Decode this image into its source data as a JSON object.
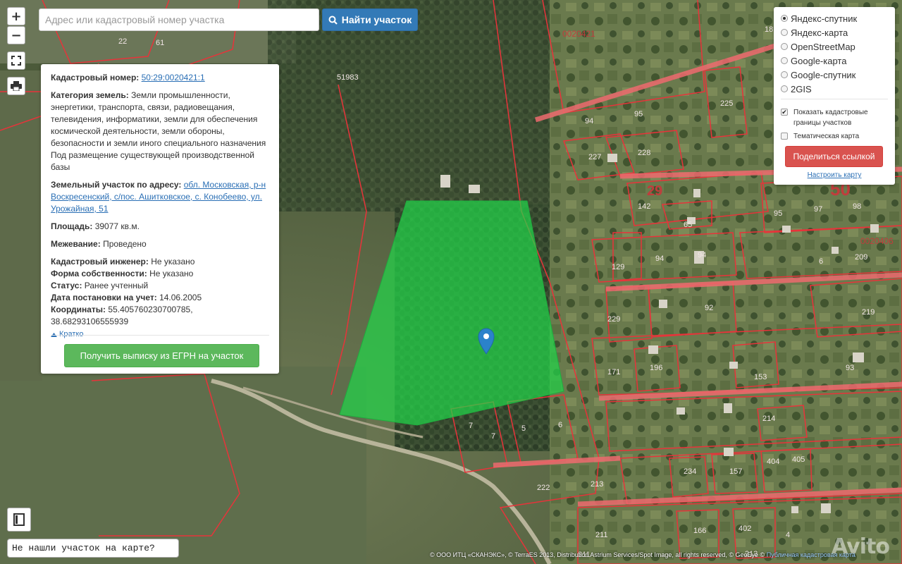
{
  "search": {
    "placeholder": "Адрес или кадастровый номер участка",
    "button_label": "Найти участок"
  },
  "controls": {
    "zoom_in": "+",
    "zoom_out": "−"
  },
  "parcel": {
    "cadastral_label": "Кадастровый номер:",
    "cadastral_value": "50:29:0020421:1",
    "category_label": "Категория земель:",
    "category_value": "Земли промышленности, энергетики, транспорта, связи, радиовещания, телевидения, информатики, земли для обеспечения космической деятельности, земли обороны, безопасности и земли иного специального назначения",
    "usage": "Под размещение существующей производственной базы",
    "address_label": "Земельный участок по адресу:",
    "address_value": "обл. Московская, р-н Воскресенский, с/пос. Ашитковское, с. Конобеево, ул. Урожайная, 51",
    "area_label": "Площадь:",
    "area_value": "39077 кв.м.",
    "survey_label": "Межевание:",
    "survey_value": "Проведено",
    "engineer_label": "Кадастровый инженер:",
    "engineer_value": "Не указано",
    "ownership_label": "Форма собственности:",
    "ownership_value": "Не указано",
    "status_label": "Статус:",
    "status_value": "Ранее учтенный",
    "date_label": "Дата постановки на учет:",
    "date_value": "14.06.2005",
    "coords_label": "Координаты:",
    "coords_value": "55.405760230700785, 38.68293106555939",
    "collapse_label": "Кратко",
    "egrn_button": "Получить выписку из ЕГРН на участок"
  },
  "layers": {
    "options": [
      {
        "label": "Яндекс-спутник",
        "selected": true
      },
      {
        "label": "Яндекс-карта",
        "selected": false
      },
      {
        "label": "OpenStreetMap",
        "selected": false
      },
      {
        "label": "Google-карта",
        "selected": false
      },
      {
        "label": "Google-спутник",
        "selected": false
      },
      {
        "label": "2GIS",
        "selected": false
      }
    ],
    "show_boundaries_label": "Показать кадастровые границы участков",
    "show_boundaries_checked": true,
    "thematic_label": "Тематическая карта",
    "thematic_checked": false,
    "share_button": "Поделиться ссылкой",
    "configure_link": "Настроить карту"
  },
  "not_found_button": "Не нашли участок на карте?",
  "attribution": {
    "text": "© ООО ИТЦ «СКАНЭКС», © TerraES 2013, Distribution Astrium Services/Spot Image, all rights reserved, © GeoEye ©",
    "link": "Публичная кадастровая карта"
  },
  "watermark": "Avito",
  "map_labels": {
    "block_0020421": "0020421",
    "block_0020406": "0020406",
    "big_29": "29",
    "big_50": "50",
    "parcels": [
      "51983",
      "22",
      "61",
      "95",
      "94",
      "228",
      "227",
      "142",
      "65",
      "97",
      "98",
      "95",
      "129",
      "94",
      "94",
      "6",
      "209",
      "229",
      "92",
      "219",
      "171",
      "196",
      "153",
      "93",
      "7",
      "7",
      "5",
      "6",
      "214",
      "213",
      "222",
      "234",
      "157",
      "404",
      "405",
      "211",
      "166",
      "402",
      "213",
      "4",
      "225",
      "211",
      "18"
    ]
  },
  "colors": {
    "parcel_fill": "#2ecc4f",
    "boundary": "#e8333a",
    "search_button": "#337ab7",
    "egrn_button": "#5cb85c",
    "share_button": "#d9534f",
    "marker": "#2b82cb"
  }
}
